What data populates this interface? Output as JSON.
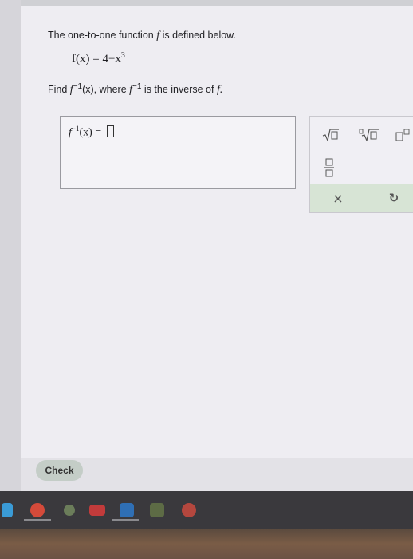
{
  "problem": {
    "intro_prefix": "The one-to-one function ",
    "intro_f": "f",
    "intro_suffix": " is defined below.",
    "func_lhs": "f(x) = 4−x",
    "func_exp": "3",
    "find_label": "Find ",
    "find_f": "f",
    "find_sup": "−1",
    "find_x": "(x), where ",
    "where_f": "f",
    "where_sup": "−1",
    "inverse_text": " is the inverse of ",
    "inverse_f": "f."
  },
  "answer": {
    "f": "f",
    "sup": "−1",
    "arg": "(x) = "
  },
  "palette": {
    "sqrt_icon": "square-root-icon",
    "nthroot_icon": "nth-root-icon",
    "power_icon": "superscript-icon",
    "fraction_icon": "fraction-icon",
    "clear_label": "×",
    "undo_label": "↻"
  },
  "actions": {
    "check_label": "Check"
  },
  "colors": {
    "page_bg": "#eeedf2",
    "palette_bottom": "#d7e4d5",
    "check_bg": "#c4cdc7"
  }
}
